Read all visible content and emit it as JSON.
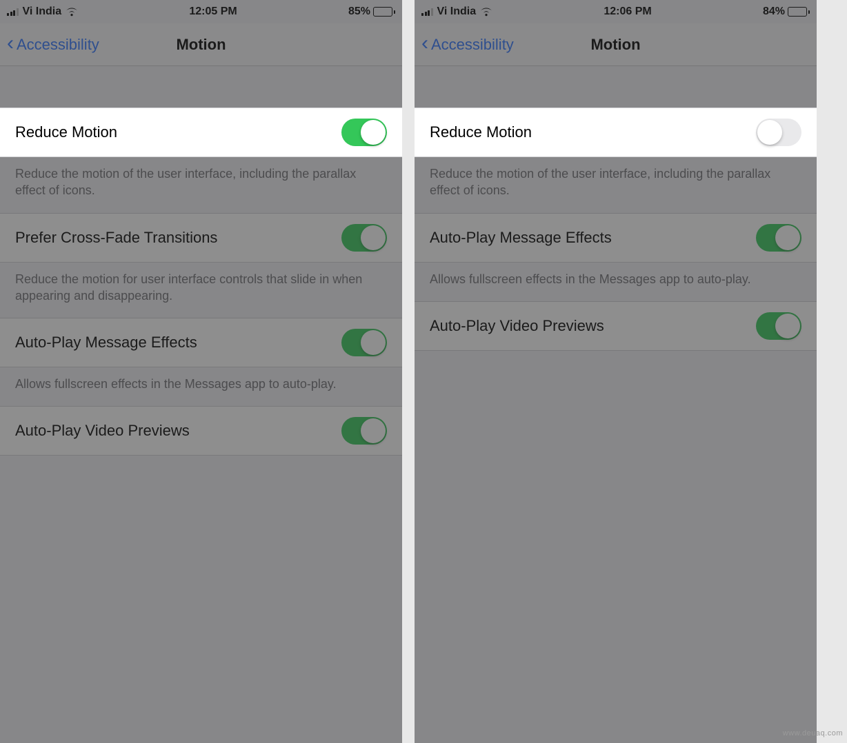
{
  "watermark": "www.deuaq.com",
  "screens": [
    {
      "statusbar": {
        "carrier": "Vi India",
        "time": "12:05 PM",
        "battery_pct": "85%",
        "battery_fill": 85
      },
      "nav": {
        "back_label": "Accessibility",
        "title": "Motion"
      },
      "rows": [
        {
          "label": "Reduce Motion",
          "on": true,
          "highlighted": true,
          "footer": "Reduce the motion of the user interface, including the parallax effect of icons."
        },
        {
          "label": "Prefer Cross-Fade Transitions",
          "on": true,
          "footer": "Reduce the motion for user interface controls that slide in when appearing and disappearing."
        },
        {
          "label": "Auto-Play Message Effects",
          "on": true,
          "footer": "Allows fullscreen effects in the Messages app to auto-play."
        },
        {
          "label": "Auto-Play Video Previews",
          "on": true,
          "footer": ""
        }
      ]
    },
    {
      "statusbar": {
        "carrier": "Vi India",
        "time": "12:06 PM",
        "battery_pct": "84%",
        "battery_fill": 84
      },
      "nav": {
        "back_label": "Accessibility",
        "title": "Motion"
      },
      "rows": [
        {
          "label": "Reduce Motion",
          "on": false,
          "highlighted": true,
          "footer": "Reduce the motion of the user interface, including the parallax effect of icons."
        },
        {
          "label": "Auto-Play Message Effects",
          "on": true,
          "footer": "Allows fullscreen effects in the Messages app to auto-play."
        },
        {
          "label": "Auto-Play Video Previews",
          "on": true,
          "footer": ""
        }
      ]
    }
  ]
}
